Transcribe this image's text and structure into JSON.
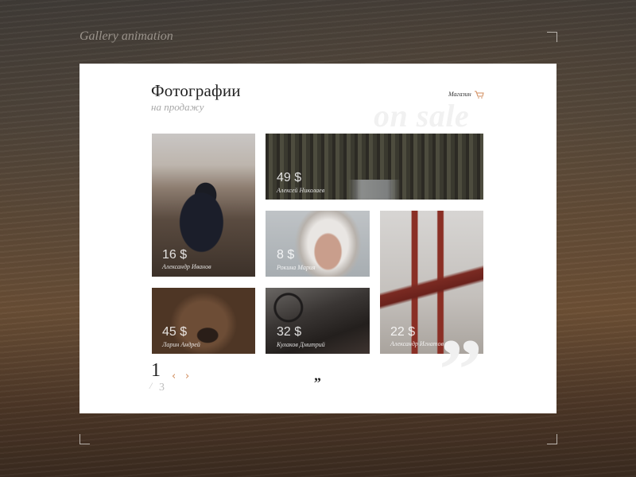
{
  "background": {
    "title": "Gallery animation"
  },
  "header": {
    "title": "Фотографии",
    "subtitle": "на продажу",
    "watermark": "on sale",
    "shop_label": "Магазин",
    "cart_icon": "cart-icon"
  },
  "photos": [
    {
      "price": "16 $",
      "author": "Александр Иванов"
    },
    {
      "price": "49 $",
      "author": "Алексей Николаев"
    },
    {
      "price": "8 $",
      "author": "Рокина Мария"
    },
    {
      "price": "22 $",
      "author": "Александр Игнатов"
    },
    {
      "price": "45 $",
      "author": "Ларин Андрей"
    },
    {
      "price": "32 $",
      "author": "Кулаков Дмитрий"
    }
  ],
  "pagination": {
    "current": "1",
    "slash": "/",
    "total": "3",
    "prev": "‹",
    "next": "›"
  },
  "quote": {
    "small": "„",
    "big": "”"
  },
  "colors": {
    "accent": "#d08b5b",
    "card": "#ffffff"
  }
}
